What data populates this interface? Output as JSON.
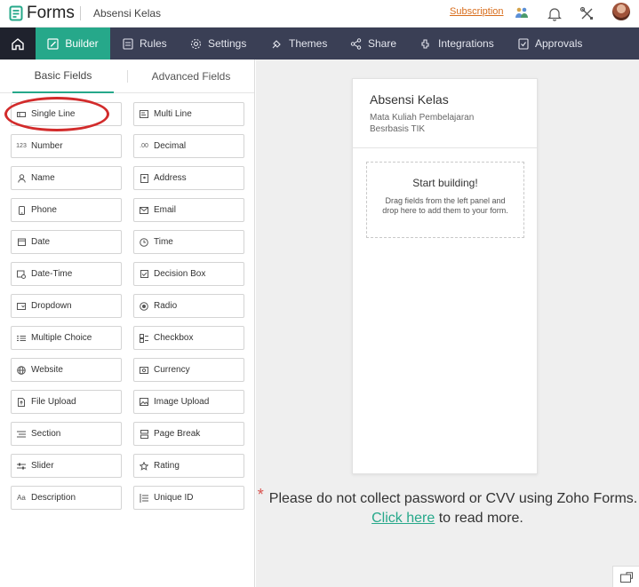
{
  "app": {
    "name": "Forms",
    "form_name": "Absensi Kelas",
    "subscription": "Subscription"
  },
  "nav": {
    "items": [
      {
        "label": "Builder",
        "icon": "builder-icon"
      },
      {
        "label": "Rules",
        "icon": "rules-icon"
      },
      {
        "label": "Settings",
        "icon": "gear-icon"
      },
      {
        "label": "Themes",
        "icon": "themes-icon"
      },
      {
        "label": "Share",
        "icon": "share-icon"
      },
      {
        "label": "Integrations",
        "icon": "integrations-icon"
      },
      {
        "label": "Approvals",
        "icon": "approvals-icon"
      }
    ]
  },
  "tabs": {
    "basic": "Basic Fields",
    "advanced": "Advanced Fields"
  },
  "fields": [
    {
      "label": "Single Line"
    },
    {
      "label": "Multi Line"
    },
    {
      "label": "Number"
    },
    {
      "label": "Decimal"
    },
    {
      "label": "Name"
    },
    {
      "label": "Address"
    },
    {
      "label": "Phone"
    },
    {
      "label": "Email"
    },
    {
      "label": "Date"
    },
    {
      "label": "Time"
    },
    {
      "label": "Date-Time"
    },
    {
      "label": "Decision Box"
    },
    {
      "label": "Dropdown"
    },
    {
      "label": "Radio"
    },
    {
      "label": "Multiple Choice"
    },
    {
      "label": "Checkbox"
    },
    {
      "label": "Website"
    },
    {
      "label": "Currency"
    },
    {
      "label": "File Upload"
    },
    {
      "label": "Image Upload"
    },
    {
      "label": "Section"
    },
    {
      "label": "Page Break"
    },
    {
      "label": "Slider"
    },
    {
      "label": "Rating"
    },
    {
      "label": "Description"
    },
    {
      "label": "Unique ID"
    }
  ],
  "form": {
    "title": "Absensi Kelas",
    "subtitle": "Mata Kuliah Pembelajaran Besrbasis TIK",
    "drop_title": "Start building!",
    "drop_text": "Drag fields from the left panel and drop here to add them to your form."
  },
  "notice": {
    "star": "*",
    "before": "Please do not collect password or CVV using Zoho Forms.",
    "link": "Click here",
    "after": "to read more."
  },
  "colors": {
    "accent": "#26a88a",
    "nav_bg": "#3a3f55",
    "highlight": "#d22b2b",
    "subscription": "#d86d1c"
  }
}
